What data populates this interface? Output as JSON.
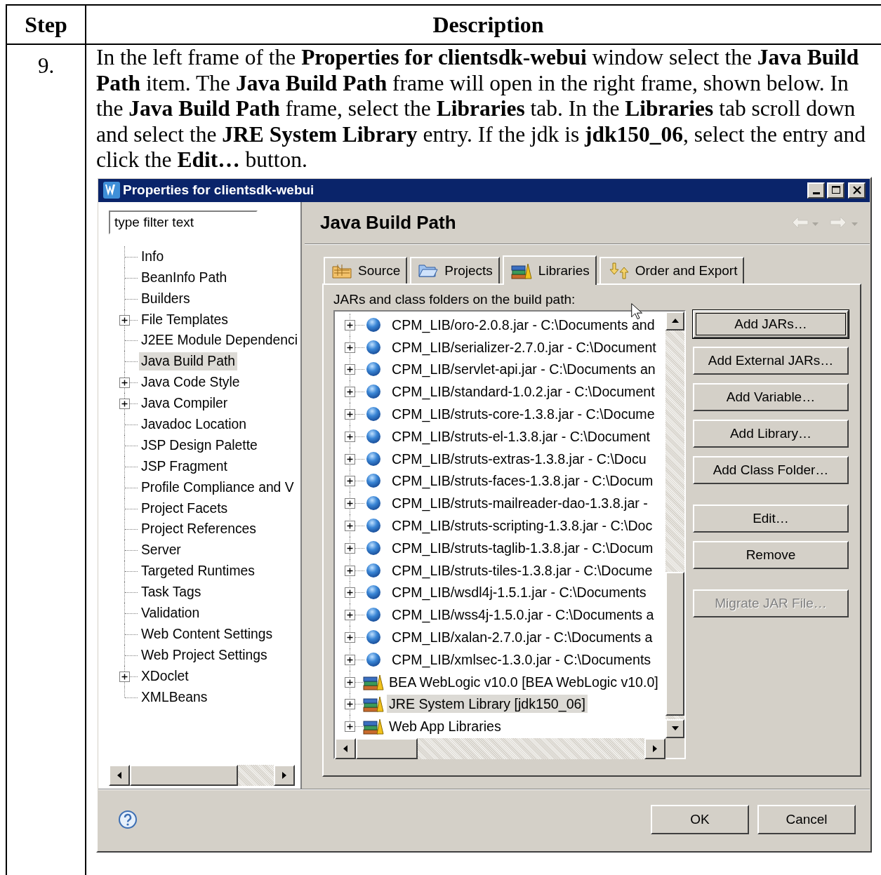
{
  "table": {
    "columns": [
      "Step",
      "Description"
    ],
    "rows": [
      {
        "step": "9.",
        "description": "In the left frame of the **Properties for clientsdk-webui** window select the **Java Build Path** item. The **Java Build Path** frame will open in the right frame, shown below. In the **Java Build Path** frame, select the **Libraries** tab. In the **Libraries** tab scroll down and select the **JRE System Library** entry. If the jdk is **jdk150_06**, select the entry and click the **Edit…** button.",
        "dialog": {
          "title": "Properties for clientsdk-webui",
          "filter": {
            "value": "type filter text"
          },
          "tree": [
            {
              "label": "Info",
              "expandable": false,
              "selected": false
            },
            {
              "label": "BeanInfo Path",
              "expandable": false,
              "selected": false
            },
            {
              "label": "Builders",
              "expandable": false,
              "selected": false
            },
            {
              "label": "File Templates",
              "expandable": true,
              "selected": false
            },
            {
              "label": "J2EE Module Dependenci",
              "expandable": false,
              "selected": false
            },
            {
              "label": "Java Build Path",
              "expandable": false,
              "selected": true
            },
            {
              "label": "Java Code Style",
              "expandable": true,
              "selected": false
            },
            {
              "label": "Java Compiler",
              "expandable": true,
              "selected": false
            },
            {
              "label": "Javadoc Location",
              "expandable": false,
              "selected": false
            },
            {
              "label": "JSP Design Palette",
              "expandable": false,
              "selected": false
            },
            {
              "label": "JSP Fragment",
              "expandable": false,
              "selected": false
            },
            {
              "label": "Profile Compliance and V",
              "expandable": false,
              "selected": false
            },
            {
              "label": "Project Facets",
              "expandable": false,
              "selected": false
            },
            {
              "label": "Project References",
              "expandable": false,
              "selected": false
            },
            {
              "label": "Server",
              "expandable": false,
              "selected": false
            },
            {
              "label": "Targeted Runtimes",
              "expandable": false,
              "selected": false
            },
            {
              "label": "Task Tags",
              "expandable": false,
              "selected": false
            },
            {
              "label": "Validation",
              "expandable": false,
              "selected": false
            },
            {
              "label": "Web Content Settings",
              "expandable": false,
              "selected": false
            },
            {
              "label": "Web Project Settings",
              "expandable": false,
              "selected": false
            },
            {
              "label": "XDoclet",
              "expandable": true,
              "selected": false
            },
            {
              "label": "XMLBeans",
              "expandable": false,
              "selected": false
            }
          ],
          "page_title": "Java Build Path",
          "tabs": [
            {
              "label": "Source",
              "selected": false
            },
            {
              "label": "Projects",
              "selected": false
            },
            {
              "label": "Libraries",
              "selected": true
            },
            {
              "label": "Order and Export",
              "selected": false
            }
          ],
          "list_label": "JARs and class folders on the build path:",
          "entries": [
            {
              "kind": "jar",
              "label": "CPM_LIB/oro-2.0.8.jar - C:\\Documents and",
              "selected": false
            },
            {
              "kind": "jar",
              "label": "CPM_LIB/serializer-2.7.0.jar - C:\\Document",
              "selected": false
            },
            {
              "kind": "jar",
              "label": "CPM_LIB/servlet-api.jar - C:\\Documents an",
              "selected": false
            },
            {
              "kind": "jar",
              "label": "CPM_LIB/standard-1.0.2.jar - C:\\Document",
              "selected": false
            },
            {
              "kind": "jar",
              "label": "CPM_LIB/struts-core-1.3.8.jar - C:\\Docume",
              "selected": false
            },
            {
              "kind": "jar",
              "label": "CPM_LIB/struts-el-1.3.8.jar - C:\\Document",
              "selected": false
            },
            {
              "kind": "jar",
              "label": "CPM_LIB/struts-extras-1.3.8.jar - C:\\Docu",
              "selected": false
            },
            {
              "kind": "jar",
              "label": "CPM_LIB/struts-faces-1.3.8.jar - C:\\Docum",
              "selected": false
            },
            {
              "kind": "jar",
              "label": "CPM_LIB/struts-mailreader-dao-1.3.8.jar -",
              "selected": false
            },
            {
              "kind": "jar",
              "label": "CPM_LIB/struts-scripting-1.3.8.jar - C:\\Doc",
              "selected": false
            },
            {
              "kind": "jar",
              "label": "CPM_LIB/struts-taglib-1.3.8.jar - C:\\Docum",
              "selected": false
            },
            {
              "kind": "jar",
              "label": "CPM_LIB/struts-tiles-1.3.8.jar - C:\\Docume",
              "selected": false
            },
            {
              "kind": "jar",
              "label": "CPM_LIB/wsdl4j-1.5.1.jar - C:\\Documents",
              "selected": false
            },
            {
              "kind": "jar",
              "label": "CPM_LIB/wss4j-1.5.0.jar - C:\\Documents a",
              "selected": false
            },
            {
              "kind": "jar",
              "label": "CPM_LIB/xalan-2.7.0.jar - C:\\Documents a",
              "selected": false
            },
            {
              "kind": "jar",
              "label": "CPM_LIB/xmlsec-1.3.0.jar - C:\\Documents",
              "selected": false
            },
            {
              "kind": "library",
              "label": "BEA WebLogic v10.0 [BEA WebLogic v10.0]",
              "selected": false
            },
            {
              "kind": "library",
              "label": "JRE System Library [jdk150_06]",
              "selected": true
            },
            {
              "kind": "library",
              "label": "Web App Libraries",
              "selected": false
            }
          ],
          "button_groups": [
            [
              {
                "label": "Add JARs…",
                "focused": true,
                "disabled": false
              },
              {
                "label": "Add External JARs…",
                "focused": false,
                "disabled": false
              },
              {
                "label": "Add Variable…",
                "focused": false,
                "disabled": false
              },
              {
                "label": "Add Library…",
                "focused": false,
                "disabled": false
              },
              {
                "label": "Add Class Folder…",
                "focused": false,
                "disabled": false
              }
            ],
            [
              {
                "label": "Edit…",
                "focused": false,
                "disabled": false
              },
              {
                "label": "Remove",
                "focused": false,
                "disabled": false
              }
            ],
            [
              {
                "label": "Migrate JAR File…",
                "focused": false,
                "disabled": true
              }
            ]
          ],
          "footer_buttons": [
            "OK",
            "Cancel"
          ]
        }
      }
    ]
  }
}
